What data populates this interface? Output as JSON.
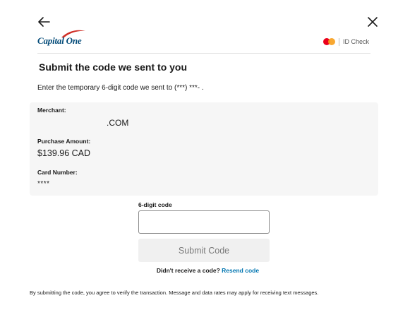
{
  "header": {
    "back_icon": "arrow-left-icon",
    "close_icon": "close-icon",
    "logo_text": "Capital One",
    "badge_icon": "mastercard-icon",
    "badge_label": "ID Check"
  },
  "main": {
    "title": "Submit the code we sent to you",
    "instruction": "Enter the temporary 6-digit code we sent to (***) ***-      ."
  },
  "details": {
    "merchant_label": "Merchant:",
    "merchant_value": ".COM",
    "amount_label": "Purchase Amount:",
    "amount_value": "$139.96 CAD",
    "card_label": "Card Number:",
    "card_value": "****"
  },
  "form": {
    "code_label": "6-digit code",
    "code_value": "",
    "submit_label": "Submit Code",
    "resend_question": "Didn't receive a code?",
    "resend_link": "Resend code"
  },
  "footer": {
    "disclaimer": "By submitting the code, you agree to verify the transaction. Message and data rates may apply for receiving text messages."
  },
  "colors": {
    "brand_navy": "#004977",
    "brand_red": "#d03027",
    "link_blue": "#0276b1",
    "panel_bg": "#f6f6f6",
    "button_disabled_bg": "#f0f0f0"
  }
}
